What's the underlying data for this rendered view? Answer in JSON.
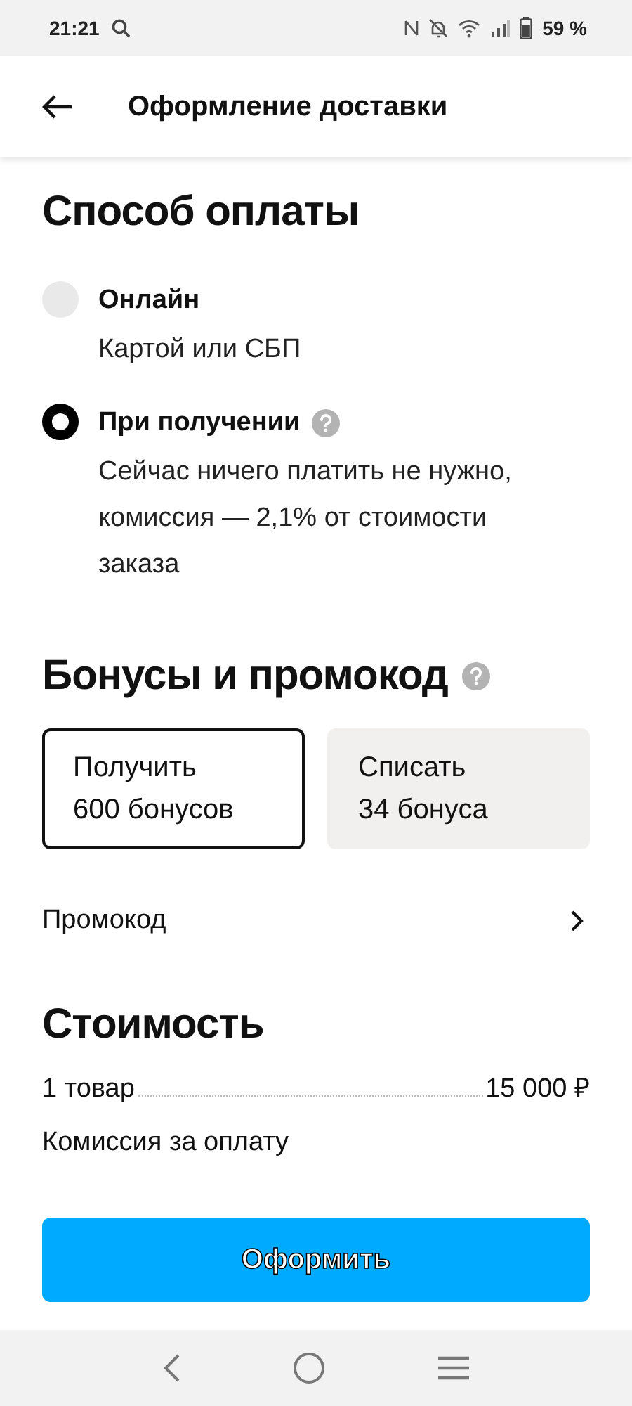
{
  "status_bar": {
    "time": "21:21",
    "battery": "59 %"
  },
  "header": {
    "title": "Оформление доставки"
  },
  "payment": {
    "title": "Способ оплаты",
    "options": [
      {
        "label": "Онлайн",
        "description": "Картой или СБП",
        "selected": false,
        "help": false
      },
      {
        "label": "При получении",
        "description": "Сейчас ничего платить не нужно, комиссия — 2,1% от стоимости заказа",
        "selected": true,
        "help": true
      }
    ]
  },
  "bonuses": {
    "title": "Бонусы и промокод",
    "options": [
      {
        "line1": "Получить",
        "line2": "600 бонусов",
        "selected": true
      },
      {
        "line1": "Списать",
        "line2": "34 бонуса",
        "selected": false
      }
    ],
    "promo": "Промокод"
  },
  "cost": {
    "title": "Стоимость",
    "rows": [
      {
        "label": "1 товар",
        "value": "15 000 ₽"
      }
    ],
    "partial_row": "Комиссия за оплату"
  },
  "checkout_button": "Оформить"
}
